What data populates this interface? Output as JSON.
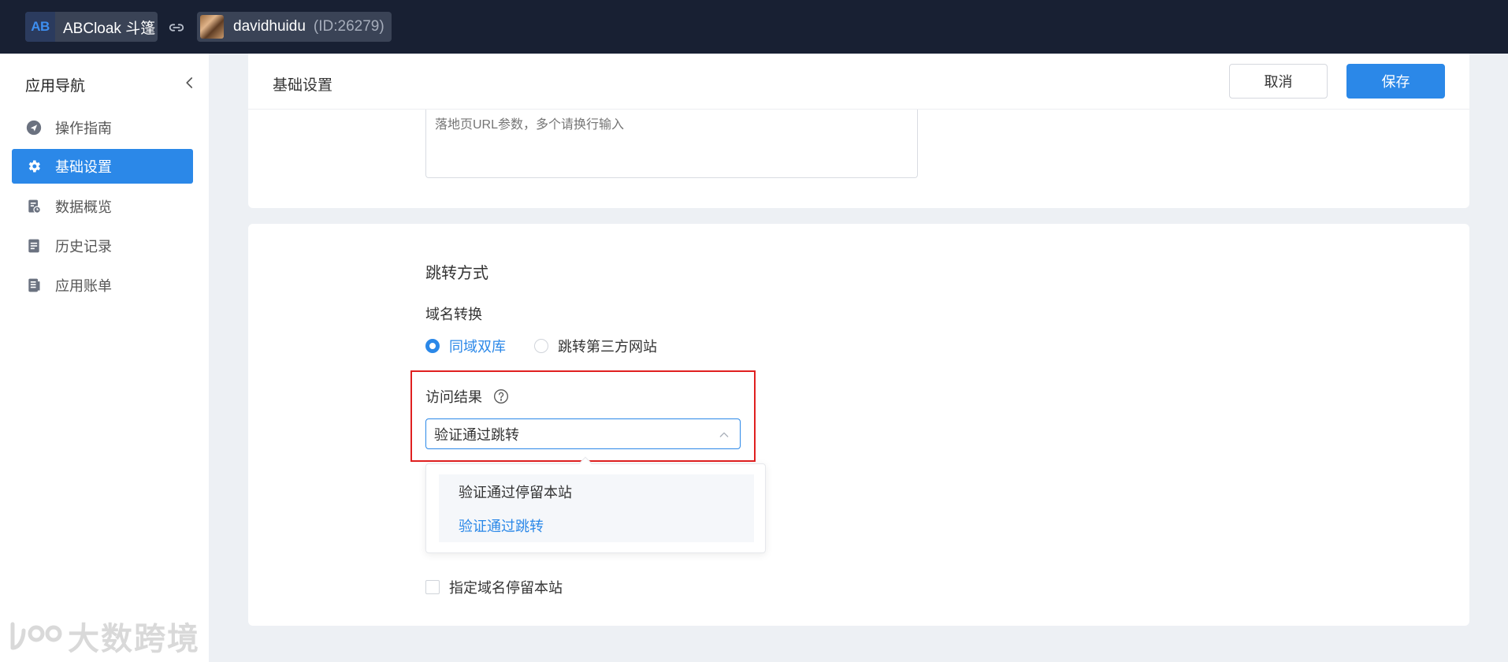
{
  "topbar": {
    "app_logo": "AB",
    "app_name": "ABCloak 斗篷",
    "user_name": "davidhuidu",
    "user_id": "(ID:26279)"
  },
  "sidebar": {
    "title": "应用导航",
    "items": [
      {
        "label": "操作指南",
        "icon": "send-icon",
        "active": false
      },
      {
        "label": "基础设置",
        "icon": "gear-icon",
        "active": true
      },
      {
        "label": "数据概览",
        "icon": "data-report-icon",
        "active": false
      },
      {
        "label": "历史记录",
        "icon": "document-icon",
        "active": false
      },
      {
        "label": "应用账单",
        "icon": "bill-icon",
        "active": false
      }
    ],
    "watermark": "大数跨境"
  },
  "header": {
    "title": "基础设置",
    "cancel_label": "取消",
    "save_label": "保存"
  },
  "url_params": {
    "placeholder": "落地页URL参数，多个请换行输入"
  },
  "redirect": {
    "section_title": "跳转方式",
    "domain_label": "域名转换",
    "radio_options": [
      {
        "label": "同域双库",
        "checked": true
      },
      {
        "label": "跳转第三方网站",
        "checked": false
      }
    ],
    "result_label": "访问结果",
    "result_value": "验证通过跳转",
    "dropdown_options": [
      {
        "label": "验证通过停留本站",
        "selected": false
      },
      {
        "label": "验证通过跳转",
        "selected": true
      }
    ],
    "checkbox_label": "指定域名停留本站"
  },
  "colors": {
    "primary": "#2b88e8",
    "topbar": "#182033",
    "highlight": "#e02020"
  }
}
